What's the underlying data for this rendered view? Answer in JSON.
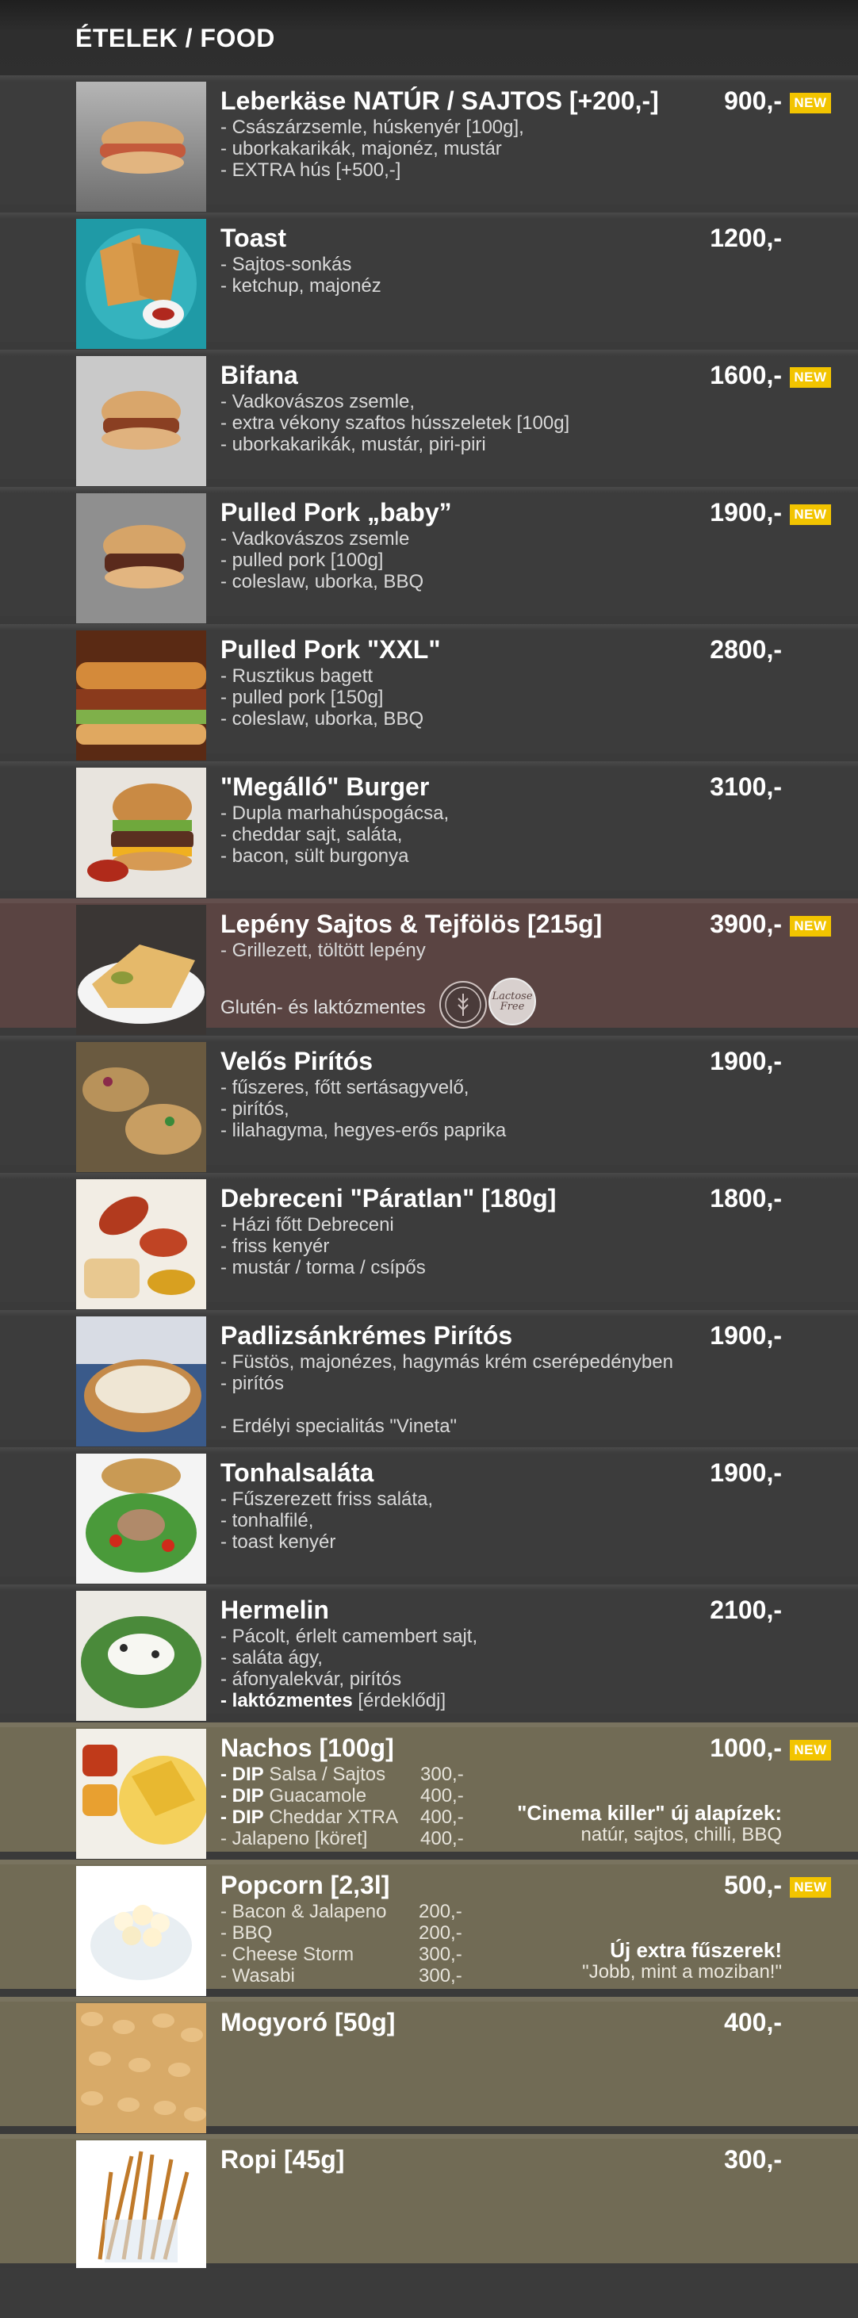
{
  "header": {
    "title": "ÉTELEK / FOOD"
  },
  "badge_label": "NEW",
  "items": [
    {
      "title": "Leberkäse  NATÚR / SAJTOS [+200,-]",
      "price": "900,-",
      "new": true,
      "desc": [
        "- Császárzsemle, húskenyér [100g],",
        "- uborkakarikák, majonéz, mustár",
        "- EXTRA hús [+500,-]"
      ]
    },
    {
      "title": "Toast",
      "price": "1200,-",
      "new": false,
      "desc": [
        "- Sajtos-sonkás",
        "- ketchup, majonéz"
      ]
    },
    {
      "title": "Bifana",
      "price": "1600,-",
      "new": true,
      "desc": [
        "- Vadkovászos zsemle,",
        "- extra vékony szaftos hússzeletek [100g]",
        "- uborkakarikák, mustár, piri-piri"
      ]
    },
    {
      "title": "Pulled Pork „baby”",
      "price": "1900,-",
      "new": true,
      "desc": [
        "- Vadkovászos zsemle",
        "- pulled pork [100g]",
        "- coleslaw, uborka, BBQ"
      ]
    },
    {
      "title": "Pulled Pork \"XXL\"",
      "price": "2800,-",
      "new": false,
      "desc": [
        "- Rusztikus bagett",
        "- pulled pork [150g]",
        "- coleslaw, uborka, BBQ"
      ]
    },
    {
      "title": "\"Megálló\" Burger",
      "price": "3100,-",
      "new": false,
      "desc": [
        "- Dupla marhahúspogácsa,",
        "- cheddar sajt, saláta,",
        "- bacon, sült burgonya"
      ]
    },
    {
      "title": "Lepény Sajtos & Tejfölös [215g]",
      "price": "3900,-",
      "new": true,
      "desc": [
        "- Grillezett, töltött lepény"
      ],
      "note": "Glutén- és laktózmentes",
      "seal_gluten": "GLUTEN FREE",
      "seal_lactose": "Lactose Free"
    },
    {
      "title": "Velős Pirítós",
      "price": "1900,-",
      "new": false,
      "desc": [
        "- fűszeres, főtt sertásagyvelő,",
        "- pirítós,",
        "- lilahagyma, hegyes-erős paprika"
      ]
    },
    {
      "title": "Debreceni \"Páratlan\" [180g]",
      "price": "1800,-",
      "new": false,
      "desc": [
        "- Házi főtt Debreceni",
        "- friss kenyér",
        "- mustár / torma / csípős"
      ]
    },
    {
      "title": "Padlizsánkrémes Pirítós",
      "price": "1900,-",
      "new": false,
      "desc": [
        "- Füstös, majonézes, hagymás krém cserépedényben",
        "- pirítós",
        "",
        "- Erdélyi specialitás \"Vineta\""
      ]
    },
    {
      "title": "Tonhalsaláta",
      "price": "1900,-",
      "new": false,
      "desc": [
        "- Fűszerezett friss saláta,",
        "- tonhalfilé,",
        "- toast kenyér"
      ]
    },
    {
      "title": "Hermelin",
      "price": "2100,-",
      "new": false,
      "desc": [
        "- Pácolt, érlelt camembert sajt,",
        "- saláta ágy,",
        "- áfonyalekvár, pirítós"
      ],
      "desc_last_bold": "- laktózmentes",
      "desc_last_rest": " [érdeklődj]"
    },
    {
      "title": "Nachos [100g]",
      "price": "1000,-",
      "new": true,
      "options": [
        {
          "bold": "- DIP",
          "name": " Salsa / Sajtos",
          "price": "300,-"
        },
        {
          "bold": "- DIP",
          "name": " Guacamole",
          "price": "400,-"
        },
        {
          "bold": "- DIP",
          "name": " Cheddar XTRA",
          "price": "400,-"
        },
        {
          "bold": "",
          "name": "- Jalapeno [köret]",
          "price": "400,-"
        }
      ],
      "side_title": "\"Cinema killer\" új alapízek:",
      "side_sub": "natúr, sajtos, chilli, BBQ"
    },
    {
      "title": "Popcorn [2,3l]",
      "price": "500,-",
      "new": true,
      "options": [
        {
          "bold": "",
          "name": "- Bacon & Jalapeno",
          "price": "200,-"
        },
        {
          "bold": "",
          "name": "- BBQ",
          "price": "200,-"
        },
        {
          "bold": "",
          "name": "- Cheese Storm",
          "price": "300,-"
        },
        {
          "bold": "",
          "name": "- Wasabi",
          "price": "300,-"
        }
      ],
      "side_title": "Új extra fűszerek!",
      "side_sub": "\"Jobb, mint a moziban!\""
    },
    {
      "title": "Mogyoró [50g]",
      "price": "400,-",
      "new": false,
      "desc": []
    },
    {
      "title": "Ropi [45g]",
      "price": "300,-",
      "new": false,
      "desc": []
    }
  ]
}
